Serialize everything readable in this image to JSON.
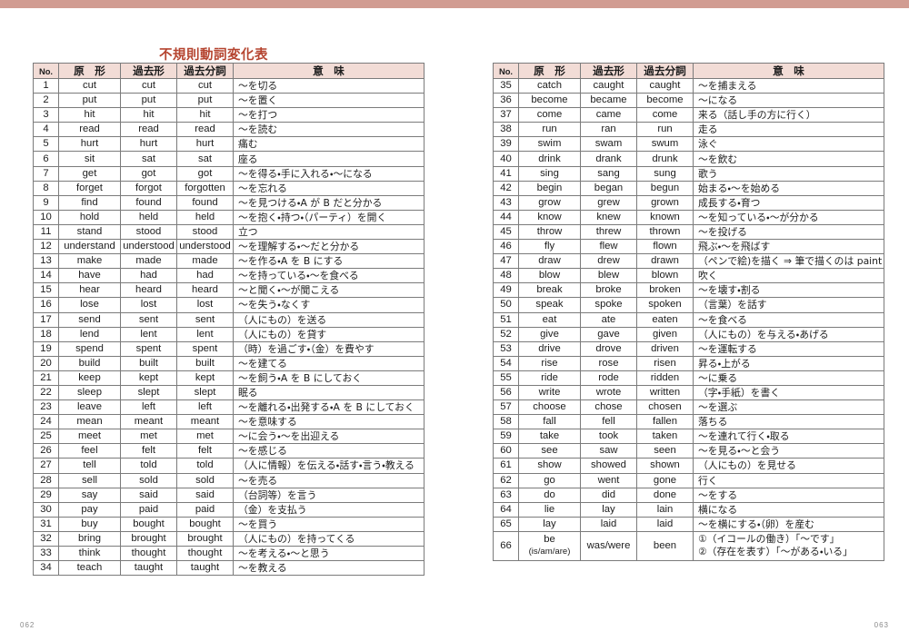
{
  "decor": {
    "top_bar_color": "#d19c92",
    "header_fill": "#f2dcd6",
    "title_color": "#b5442f",
    "border_color": "#7b7b7b"
  },
  "title": "不規則動詞変化表",
  "columns": {
    "no": "No.",
    "base": "原　形",
    "past": "過去形",
    "past_participle": "過去分詞",
    "meaning": "意　味"
  },
  "left_page": {
    "page_number": "062",
    "rows": [
      {
        "no": "1",
        "base": "cut",
        "past": "cut",
        "pp": "cut",
        "meaning": "〜を切る"
      },
      {
        "no": "2",
        "base": "put",
        "past": "put",
        "pp": "put",
        "meaning": "〜を置く"
      },
      {
        "no": "3",
        "base": "hit",
        "past": "hit",
        "pp": "hit",
        "meaning": "〜を打つ"
      },
      {
        "no": "4",
        "base": "read",
        "past": "read",
        "pp": "read",
        "meaning": "〜を読む"
      },
      {
        "no": "5",
        "base": "hurt",
        "past": "hurt",
        "pp": "hurt",
        "meaning": "痛む"
      },
      {
        "no": "6",
        "base": "sit",
        "past": "sat",
        "pp": "sat",
        "meaning": "座る"
      },
      {
        "no": "7",
        "base": "get",
        "past": "got",
        "pp": "got",
        "meaning": "〜を得る・手に入れる・〜になる"
      },
      {
        "no": "8",
        "base": "forget",
        "past": "forgot",
        "pp": "forgotten",
        "meaning": "〜を忘れる"
      },
      {
        "no": "9",
        "base": "find",
        "past": "found",
        "pp": "found",
        "meaning": "〜を見つける・A が B だと分かる"
      },
      {
        "no": "10",
        "base": "hold",
        "past": "held",
        "pp": "held",
        "meaning": "〜を抱く・持つ・（パーティ）を開く"
      },
      {
        "no": "11",
        "base": "stand",
        "past": "stood",
        "pp": "stood",
        "meaning": "立つ"
      },
      {
        "no": "12",
        "base": "understand",
        "past": "understood",
        "pp": "understood",
        "meaning": "〜を理解する・〜だと分かる"
      },
      {
        "no": "13",
        "base": "make",
        "past": "made",
        "pp": "made",
        "meaning": "〜を作る・A を B にする"
      },
      {
        "no": "14",
        "base": "have",
        "past": "had",
        "pp": "had",
        "meaning": "〜を持っている・〜を食べる"
      },
      {
        "no": "15",
        "base": "hear",
        "past": "heard",
        "pp": "heard",
        "meaning": "〜と聞く・〜が聞こえる"
      },
      {
        "no": "16",
        "base": "lose",
        "past": "lost",
        "pp": "lost",
        "meaning": "〜を失う・なくす"
      },
      {
        "no": "17",
        "base": "send",
        "past": "sent",
        "pp": "sent",
        "meaning": "（人にもの）を送る"
      },
      {
        "no": "18",
        "base": "lend",
        "past": "lent",
        "pp": "lent",
        "meaning": "（人にもの）を貸す"
      },
      {
        "no": "19",
        "base": "spend",
        "past": "spent",
        "pp": "spent",
        "meaning": "（時）を過ごす・（金）を費やす"
      },
      {
        "no": "20",
        "base": "build",
        "past": "built",
        "pp": "built",
        "meaning": "〜を建てる"
      },
      {
        "no": "21",
        "base": "keep",
        "past": "kept",
        "pp": "kept",
        "meaning": "〜を飼う・A を B にしておく"
      },
      {
        "no": "22",
        "base": "sleep",
        "past": "slept",
        "pp": "slept",
        "meaning": "眠る"
      },
      {
        "no": "23",
        "base": "leave",
        "past": "left",
        "pp": "left",
        "meaning": "〜を離れる・出発する・A を B にしておく"
      },
      {
        "no": "24",
        "base": "mean",
        "past": "meant",
        "pp": "meant",
        "meaning": "〜を意味する"
      },
      {
        "no": "25",
        "base": "meet",
        "past": "met",
        "pp": "met",
        "meaning": "〜に会う・〜を出迎える"
      },
      {
        "no": "26",
        "base": "feel",
        "past": "felt",
        "pp": "felt",
        "meaning": "〜を感じる"
      },
      {
        "no": "27",
        "base": "tell",
        "past": "told",
        "pp": "told",
        "meaning": "（人に情報）を伝える・話す・言う・教える"
      },
      {
        "no": "28",
        "base": "sell",
        "past": "sold",
        "pp": "sold",
        "meaning": "〜を売る"
      },
      {
        "no": "29",
        "base": "say",
        "past": "said",
        "pp": "said",
        "meaning": "（台詞等）を言う"
      },
      {
        "no": "30",
        "base": "pay",
        "past": "paid",
        "pp": "paid",
        "meaning": "（金）を支払う"
      },
      {
        "no": "31",
        "base": "buy",
        "past": "bought",
        "pp": "bought",
        "meaning": "〜を買う"
      },
      {
        "no": "32",
        "base": "bring",
        "past": "brought",
        "pp": "brought",
        "meaning": "（人にもの）を持ってくる"
      },
      {
        "no": "33",
        "base": "think",
        "past": "thought",
        "pp": "thought",
        "meaning": "〜を考える・〜と思う"
      },
      {
        "no": "34",
        "base": "teach",
        "past": "taught",
        "pp": "taught",
        "meaning": "〜を教える"
      }
    ]
  },
  "right_page": {
    "page_number": "063",
    "rows": [
      {
        "no": "35",
        "base": "catch",
        "past": "caught",
        "pp": "caught",
        "meaning": "〜を捕まえる"
      },
      {
        "no": "36",
        "base": "become",
        "past": "became",
        "pp": "become",
        "meaning": "〜になる"
      },
      {
        "no": "37",
        "base": "come",
        "past": "came",
        "pp": "come",
        "meaning": "来る（話し手の方に行く）"
      },
      {
        "no": "38",
        "base": "run",
        "past": "ran",
        "pp": "run",
        "meaning": "走る"
      },
      {
        "no": "39",
        "base": "swim",
        "past": "swam",
        "pp": "swum",
        "meaning": "泳ぐ"
      },
      {
        "no": "40",
        "base": "drink",
        "past": "drank",
        "pp": "drunk",
        "meaning": "〜を飲む"
      },
      {
        "no": "41",
        "base": "sing",
        "past": "sang",
        "pp": "sung",
        "meaning": "歌う"
      },
      {
        "no": "42",
        "base": "begin",
        "past": "began",
        "pp": "begun",
        "meaning": "始まる・〜を始める"
      },
      {
        "no": "43",
        "base": "grow",
        "past": "grew",
        "pp": "grown",
        "meaning": "成長する・育つ"
      },
      {
        "no": "44",
        "base": "know",
        "past": "knew",
        "pp": "known",
        "meaning": "〜を知っている・〜が分かる"
      },
      {
        "no": "45",
        "base": "throw",
        "past": "threw",
        "pp": "thrown",
        "meaning": "〜を投げる"
      },
      {
        "no": "46",
        "base": "fly",
        "past": "flew",
        "pp": "flown",
        "meaning": "飛ぶ・〜を飛ばす"
      },
      {
        "no": "47",
        "base": "draw",
        "past": "drew",
        "pp": "drawn",
        "meaning": "（ペンで絵)を描く ⇒ 筆で描くのは paint"
      },
      {
        "no": "48",
        "base": "blow",
        "past": "blew",
        "pp": "blown",
        "meaning": "吹く"
      },
      {
        "no": "49",
        "base": "break",
        "past": "broke",
        "pp": "broken",
        "meaning": "〜を壊す・割る"
      },
      {
        "no": "50",
        "base": "speak",
        "past": "spoke",
        "pp": "spoken",
        "meaning": "（言葉）を話す"
      },
      {
        "no": "51",
        "base": "eat",
        "past": "ate",
        "pp": "eaten",
        "meaning": "〜を食べる"
      },
      {
        "no": "52",
        "base": "give",
        "past": "gave",
        "pp": "given",
        "meaning": "（人にもの）を与える・あげる"
      },
      {
        "no": "53",
        "base": "drive",
        "past": "drove",
        "pp": "driven",
        "meaning": "〜を運転する"
      },
      {
        "no": "54",
        "base": "rise",
        "past": "rose",
        "pp": "risen",
        "meaning": "昇る・上がる"
      },
      {
        "no": "55",
        "base": "ride",
        "past": "rode",
        "pp": "ridden",
        "meaning": "〜に乗る"
      },
      {
        "no": "56",
        "base": "write",
        "past": "wrote",
        "pp": "written",
        "meaning": "（字・手紙）を書く"
      },
      {
        "no": "57",
        "base": "choose",
        "past": "chose",
        "pp": "chosen",
        "meaning": "〜を選ぶ"
      },
      {
        "no": "58",
        "base": "fall",
        "past": "fell",
        "pp": "fallen",
        "meaning": "落ちる"
      },
      {
        "no": "59",
        "base": "take",
        "past": "took",
        "pp": "taken",
        "meaning": "〜を連れて行く・取る"
      },
      {
        "no": "60",
        "base": "see",
        "past": "saw",
        "pp": "seen",
        "meaning": "〜を見る・〜と会う"
      },
      {
        "no": "61",
        "base": "show",
        "past": "showed",
        "pp": "shown",
        "meaning": "（人にもの）を見せる"
      },
      {
        "no": "62",
        "base": "go",
        "past": "went",
        "pp": "gone",
        "meaning": "行く"
      },
      {
        "no": "63",
        "base": "do",
        "past": "did",
        "pp": "done",
        "meaning": "〜をする"
      },
      {
        "no": "64",
        "base": "lie",
        "past": "lay",
        "pp": "lain",
        "meaning": "横になる"
      },
      {
        "no": "65",
        "base": "lay",
        "past": "laid",
        "pp": "laid",
        "meaning": "〜を横にする・（卵）を産む"
      }
    ],
    "be_row": {
      "no": "66",
      "base": "be",
      "base_sub": "(is/am/are)",
      "past": "was/were",
      "pp": "been",
      "meaning_line1": "①（イコールの働き）「〜です」",
      "meaning_line2": "②（存在を表す）「〜がある・いる」"
    }
  }
}
